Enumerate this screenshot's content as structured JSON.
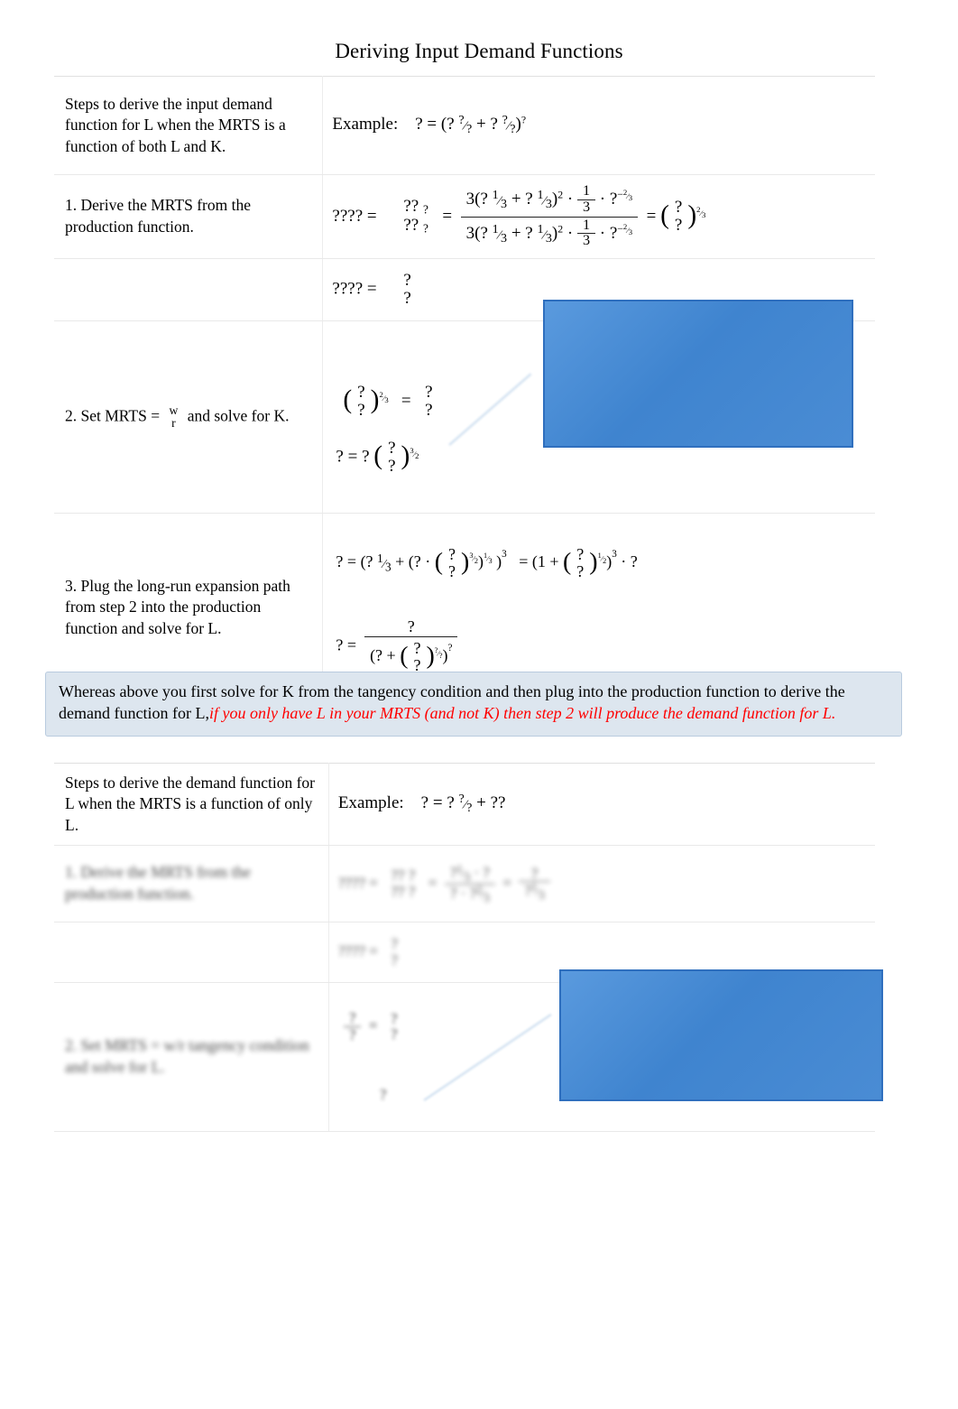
{
  "document": {
    "title": "Deriving Input Demand Functions"
  },
  "table1": {
    "header": {
      "left": "Steps to derive the input demand function for L when the MRTS is a function of both L and K.",
      "right_label": "Example:",
      "right_equation": "? = (? ?/? + ? ?/?)?"
    },
    "rows": [
      {
        "step": "1. Derive the MRTS from the production function.",
        "eq_lead": "???? =",
        "frac1_num": "?? ?",
        "frac1_den": "?? ?",
        "eq_mid": "=",
        "frac2_num": "3(? 1/3 + ? 1/3)2 · 1/3 · ? −2/3",
        "frac2_den": "3(? 1/3 + ? 1/3)2 · 1/3 · ? −2/3",
        "eq_tail": "= ( ? / ? ) 2/3"
      },
      {
        "step": "",
        "eq_lead": "???? =",
        "frac1_num": "?",
        "frac1_den": "?"
      },
      {
        "step": "2. Set MRTS = w/r and solve for K.",
        "step_pre": "2. Set",
        "step_mrts": "MRTS",
        "step_eq": "=",
        "step_w": "w",
        "step_r": "r",
        "step_post": "and solve for K.",
        "line_a": "( ? / ? ) 2/3  =  ? / ?",
        "line_b": "? = ? ( ? / ? ) 3/2"
      },
      {
        "step": "3. Plug the long-run expansion path from step 2 into the production function and solve for L.",
        "line_a": "? = (? 1/3 + (? · ( ? / ? ) 3/2 ) 1/3 ) 3  = (1 + ( ? / ? ) 1/2 ) 3 · ?",
        "line_b": "? =  ?  /  (? + ( ? / ? ) ?/? ) ?"
      }
    ]
  },
  "callout1": {
    "text": "",
    "accent_color": "#4a8cd4",
    "border_color": "#2f6fbe"
  },
  "note": {
    "black_part": "Whereas above you first solve for K from the tangency condition and then plug into the production function to derive the demand function for L,",
    "red_part": "if you only have L in your MRTS (and not K) then step 2 will produce the demand function for L.",
    "background_color": "#dde6ef",
    "red_color": "#ff0000"
  },
  "table2": {
    "header": {
      "left": "Steps to derive the demand function for L when the MRTS is a function of only L.",
      "right_label": "Example:",
      "right_equation": "? = ? ?/? + ??"
    },
    "rows": [
      {
        "step": "1. Derive the MRTS from the production function.",
        "eq": "???? = ?? ? / ?? ? = … = …",
        "legible": false
      },
      {
        "step": "",
        "eq": "???? = ? / ?",
        "legible": false
      },
      {
        "step": "2. Set MRTS = w/r tangency condition and solve for L.",
        "eq": "? / ? = ? / ?",
        "legible": false
      }
    ]
  },
  "callout2": {
    "text": "",
    "accent_color": "#4a8cd4",
    "border_color": "#2f6fbe"
  }
}
